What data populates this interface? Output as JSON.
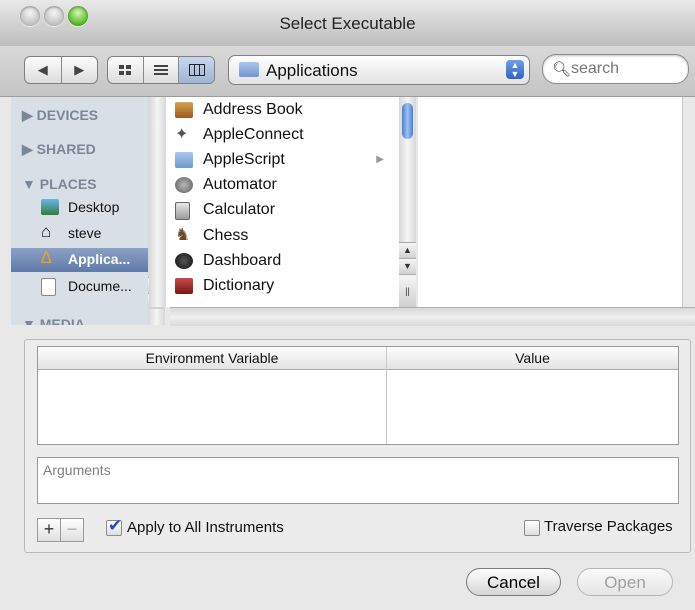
{
  "window": {
    "title": "Select Executable"
  },
  "toolbar": {
    "nav": [
      "◀",
      "▶"
    ],
    "views": [
      "icon-view",
      "list-view",
      "column-view"
    ],
    "location": "Applications",
    "search_placeholder": "search"
  },
  "sidebar": {
    "devices_label": "DEVICES",
    "shared_label": "SHARED",
    "places_label": "PLACES",
    "media_label": "MEDIA",
    "places": [
      {
        "label": "Desktop",
        "icon": "desktop-icon"
      },
      {
        "label": "steve",
        "icon": "home-icon"
      },
      {
        "label": "Applica...",
        "icon": "applications-icon"
      },
      {
        "label": "Docume...",
        "icon": "documents-icon"
      }
    ]
  },
  "browser": {
    "items": [
      {
        "label": "Address Book",
        "icon": "address-book-icon"
      },
      {
        "label": "AppleConnect",
        "icon": "appleconnect-icon"
      },
      {
        "label": "AppleScript",
        "icon": "folder-icon",
        "is_folder": true
      },
      {
        "label": "Automator",
        "icon": "automator-icon"
      },
      {
        "label": "Calculator",
        "icon": "calculator-icon"
      },
      {
        "label": "Chess",
        "icon": "chess-icon"
      },
      {
        "label": "Dashboard",
        "icon": "dashboard-icon"
      },
      {
        "label": "Dictionary",
        "icon": "dictionary-icon"
      }
    ]
  },
  "env_table": {
    "col1": "Environment Variable",
    "col2": "Value"
  },
  "arguments": {
    "placeholder": "Arguments"
  },
  "controls": {
    "add": "+",
    "remove": "−",
    "apply_all": "Apply to All Instruments",
    "apply_all_checked": true,
    "traverse": "Traverse Packages",
    "traverse_checked": false
  },
  "buttons": {
    "cancel": "Cancel",
    "open": "Open"
  }
}
